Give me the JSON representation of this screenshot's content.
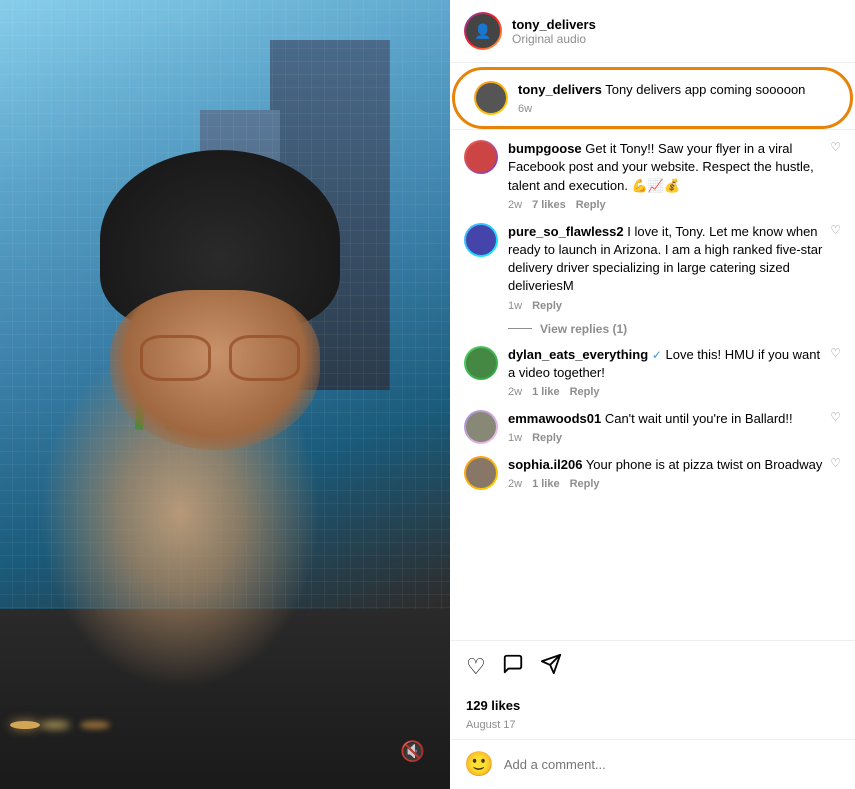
{
  "header": {
    "username": "tony_delivers",
    "subtitle": "Original audio"
  },
  "highlighted_comment": {
    "username": "tony_delivers",
    "text": "Tony delivers app coming sooooon",
    "time": "6w"
  },
  "comments": [
    {
      "id": "bumpgoose",
      "username": "bumpgoose",
      "text": "Get it Tony!! Saw your flyer in a viral Facebook post and your website. Respect the hustle, talent and execution. 💪📈💰",
      "time": "2w",
      "likes": "7 likes",
      "reply": "Reply",
      "has_heart": false
    },
    {
      "id": "pure_so_flawless2",
      "username": "pure_so_flawless2",
      "text": "I love it, Tony. Let me know when ready to launch in Arizona. I am a high ranked five-star delivery driver specializing in large catering sized deliveriesM",
      "time": "1w",
      "likes": "",
      "reply": "Reply",
      "has_heart": false,
      "view_replies": "View replies (1)"
    },
    {
      "id": "dylan_eats_everything",
      "username": "dylan_eats_everything",
      "verified": true,
      "text": "Love this! HMU if you want a video together!",
      "time": "2w",
      "likes": "1 like",
      "reply": "Reply",
      "has_heart": false
    },
    {
      "id": "emmawoods01",
      "username": "emmawoods01",
      "text": "Can't wait until you're in Ballard!!",
      "time": "1w",
      "likes": "",
      "reply": "Reply",
      "has_heart": false
    },
    {
      "id": "sophia_il206",
      "username": "sophia.il206",
      "text": "Your phone is at pizza twist on Broadway",
      "time": "2w",
      "likes": "1 like",
      "reply": "Reply",
      "has_heart": false
    }
  ],
  "actions": {
    "heart_icon": "♡",
    "comment_icon": "○",
    "share_icon": "▷"
  },
  "likes_count": "129 likes",
  "post_date": "August 17",
  "add_comment": {
    "placeholder": "Add a comment...",
    "emoji": "🙂"
  },
  "mute_icon": "🔇"
}
